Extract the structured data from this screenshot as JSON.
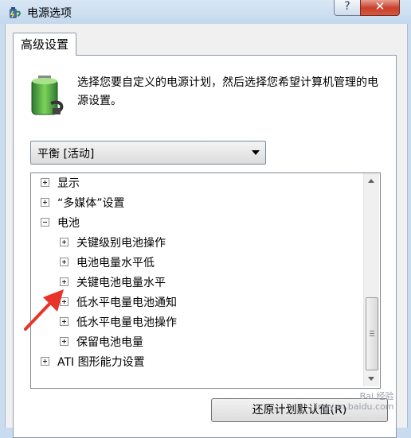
{
  "window": {
    "title": "电源选项",
    "help_label": "?",
    "close_label": "✕",
    "app_icon": "power-options-icon"
  },
  "tab": {
    "label": "高级设置"
  },
  "description": {
    "icon": "battery-icon",
    "text": "选择您要自定义的电源计划，然后选择您希望计算机管理的电源设置。"
  },
  "plan_select": {
    "value": "平衡 [活动]"
  },
  "tree": {
    "items": [
      {
        "label": "显示",
        "expanded": false,
        "level": 0
      },
      {
        "label": "“多媒体”设置",
        "expanded": false,
        "level": 0
      },
      {
        "label": "电池",
        "expanded": true,
        "level": 0
      },
      {
        "label": "关键级别电池操作",
        "expanded": false,
        "level": 1
      },
      {
        "label": "电池电量水平低",
        "expanded": false,
        "level": 1
      },
      {
        "label": "关键电池电量水平",
        "expanded": false,
        "level": 1
      },
      {
        "label": "低水平电量电池通知",
        "expanded": false,
        "level": 1
      },
      {
        "label": "低水平电量电池操作",
        "expanded": false,
        "level": 1
      },
      {
        "label": "保留电池电量",
        "expanded": false,
        "level": 1
      },
      {
        "label": "ATI 图形能力设置",
        "expanded": false,
        "level": 0
      }
    ]
  },
  "buttons": {
    "restore_defaults": "还原计划默认值(R)"
  },
  "watermark": {
    "line1": "Bai 经验",
    "line2": "jingyan.baidu.com"
  },
  "colors": {
    "annotation_arrow": "#e8332a",
    "close_button": "#c8402d"
  }
}
